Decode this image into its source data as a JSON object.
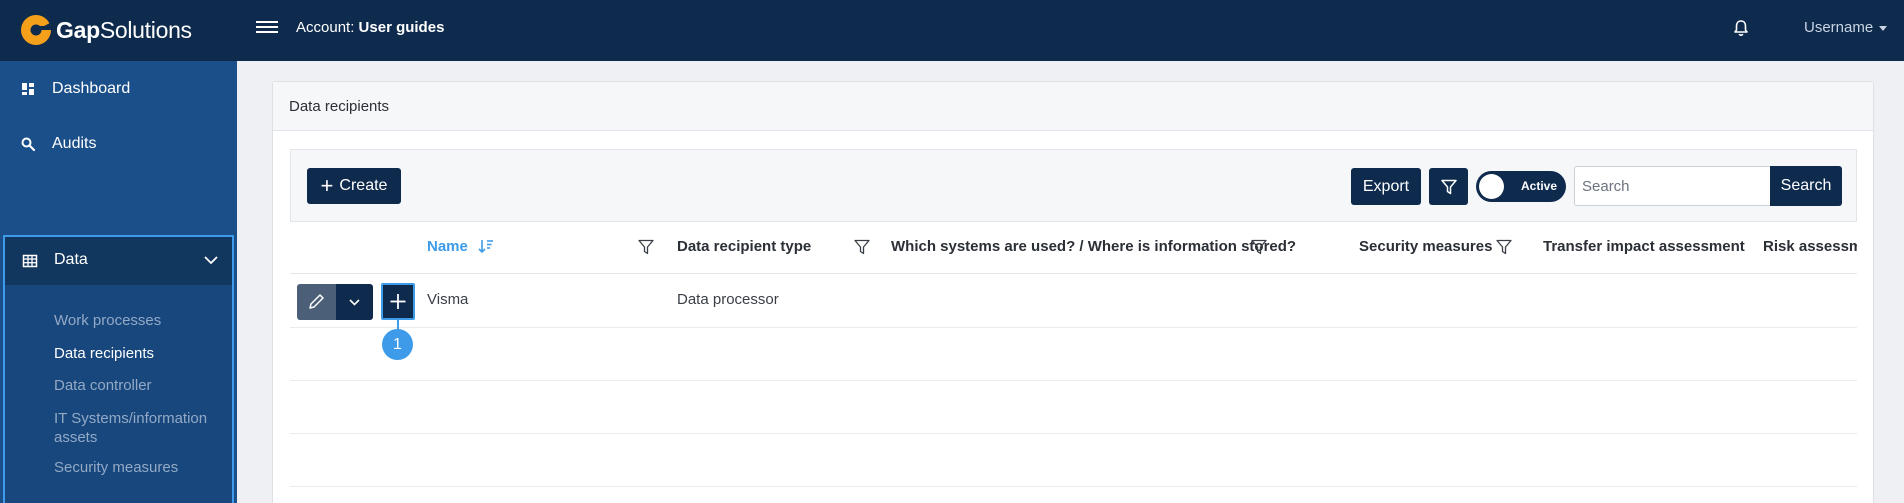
{
  "app": {
    "brand_bold": "Gap",
    "brand_light": "Solutions",
    "account_label": "Account:",
    "account_name": "User guides",
    "username": "Username"
  },
  "sidebar": {
    "items": [
      {
        "label": "Dashboard",
        "icon": "dashboard-icon"
      },
      {
        "label": "Audits",
        "icon": "search-icon"
      }
    ],
    "data_section": {
      "label": "Data",
      "icon": "table-icon",
      "expanded": true,
      "sub_items": [
        {
          "label": "Work processes",
          "active": false
        },
        {
          "label": "Data recipients",
          "active": true
        },
        {
          "label": "Data controller",
          "active": false
        },
        {
          "label": "IT Systems/information assets",
          "active": false
        },
        {
          "label": "Security measures",
          "active": false
        }
      ]
    }
  },
  "panel": {
    "title": "Data recipients"
  },
  "toolbar": {
    "create_label": "Create",
    "export_label": "Export",
    "toggle_label": "Active",
    "search_placeholder": "Search",
    "search_button": "Search"
  },
  "table": {
    "columns": [
      {
        "label": "Name",
        "sorted": true,
        "filter": true
      },
      {
        "label": "Data recipient type",
        "filter": true
      },
      {
        "label": "Which systems are used? / Where is information stored?",
        "filter": true
      },
      {
        "label": "Security measures",
        "filter": true
      },
      {
        "label": "Transfer impact assessment",
        "filter": false
      },
      {
        "label": "Risk assessm",
        "filter": false
      }
    ],
    "rows": [
      {
        "name": "Visma",
        "type": "Data processor"
      }
    ]
  },
  "callout": {
    "number": "1"
  },
  "colors": {
    "topbar": "#0e2a4d",
    "sidebar": "#1b4f8a",
    "accent": "#3d9be9",
    "brand_orange": "#f5a01a"
  }
}
